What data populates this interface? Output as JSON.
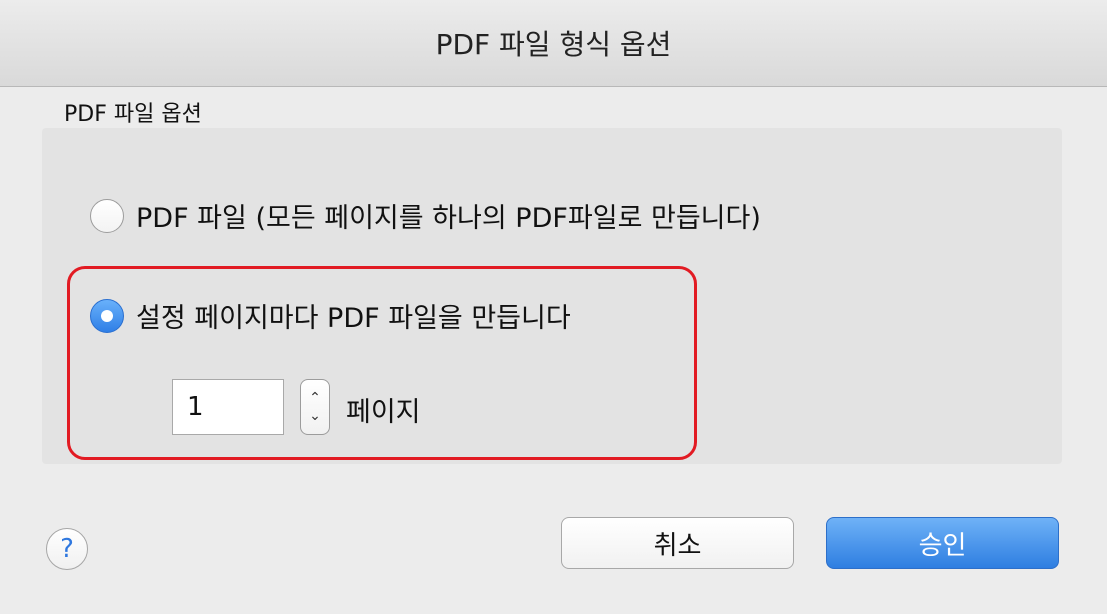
{
  "window": {
    "title": "PDF 파일 형식 옵션"
  },
  "group": {
    "label": "PDF 파일 옵션",
    "options": [
      {
        "label": "PDF 파일 (모든 페이지를 하나의 PDF파일로 만듭니다)",
        "selected": false
      },
      {
        "label": "설정 페이지마다 PDF 파일을 만듭니다",
        "selected": true
      }
    ],
    "pages": {
      "value": "1",
      "unit_label": "페이지"
    }
  },
  "footer": {
    "help_label": "?",
    "cancel_label": "취소",
    "ok_label": "승인"
  },
  "colors": {
    "highlight_border": "#e21b23",
    "accent_blue": "#2e7ee1"
  }
}
